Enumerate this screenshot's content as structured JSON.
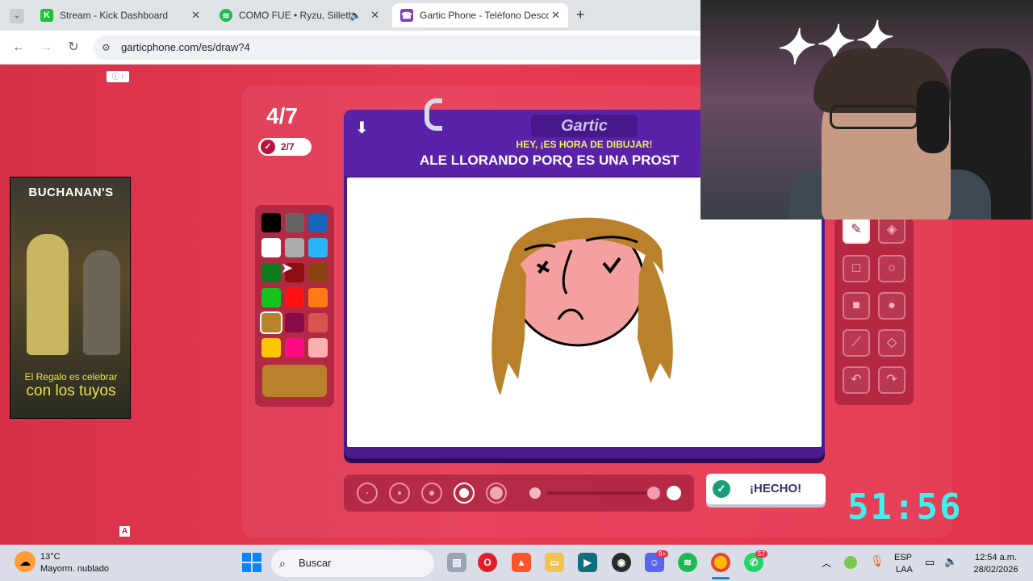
{
  "browser": {
    "tabs": [
      {
        "title": "Stream - Kick Dashboard",
        "icon": "kick-icon"
      },
      {
        "title": "COMO FUE • Ryzu, Silleth",
        "icon": "spotify-icon"
      },
      {
        "title": "Gartic Phone - Teléfono Descor",
        "icon": "gartic-icon"
      }
    ],
    "url": "garticphone.com/es/draw?4"
  },
  "ad": {
    "brand": "BUCHANAN'S",
    "slogan_top": "El Regalo es celebrar",
    "slogan": "con los tuyos"
  },
  "game": {
    "round": "4/7",
    "progress": "2/7",
    "logo": "Gartic",
    "subtitle": "HEY, ¡ES HORA DE DIBUJAR!",
    "prompt": "ALE LLORANDO PORQ ES UNA PROST",
    "done_label": "¡HECHO!",
    "timer": "51:56",
    "selected_color": "#b9812a",
    "palette": [
      "#000000",
      "#666666",
      "#1565c0",
      "#ffffff",
      "#aaaaaa",
      "#29b6f6",
      "#0f7a1e",
      "#8e0e12",
      "#8b4513",
      "#16c21c",
      "#ff1010",
      "#ff7a12",
      "#b9812a",
      "#8b0a4a",
      "#d9544f",
      "#ffc400",
      "#ff0a80",
      "#ffb0ae"
    ]
  },
  "taskbar": {
    "weather_temp": "13°C",
    "weather_desc": "Mayorm. nublado",
    "search_label": "Buscar",
    "lang_top": "ESP",
    "lang_bottom": "LAA",
    "time": "12:54 a.m.",
    "date": "28/02/2026",
    "discord_badge": "9+",
    "whatsapp_badge": "57"
  }
}
